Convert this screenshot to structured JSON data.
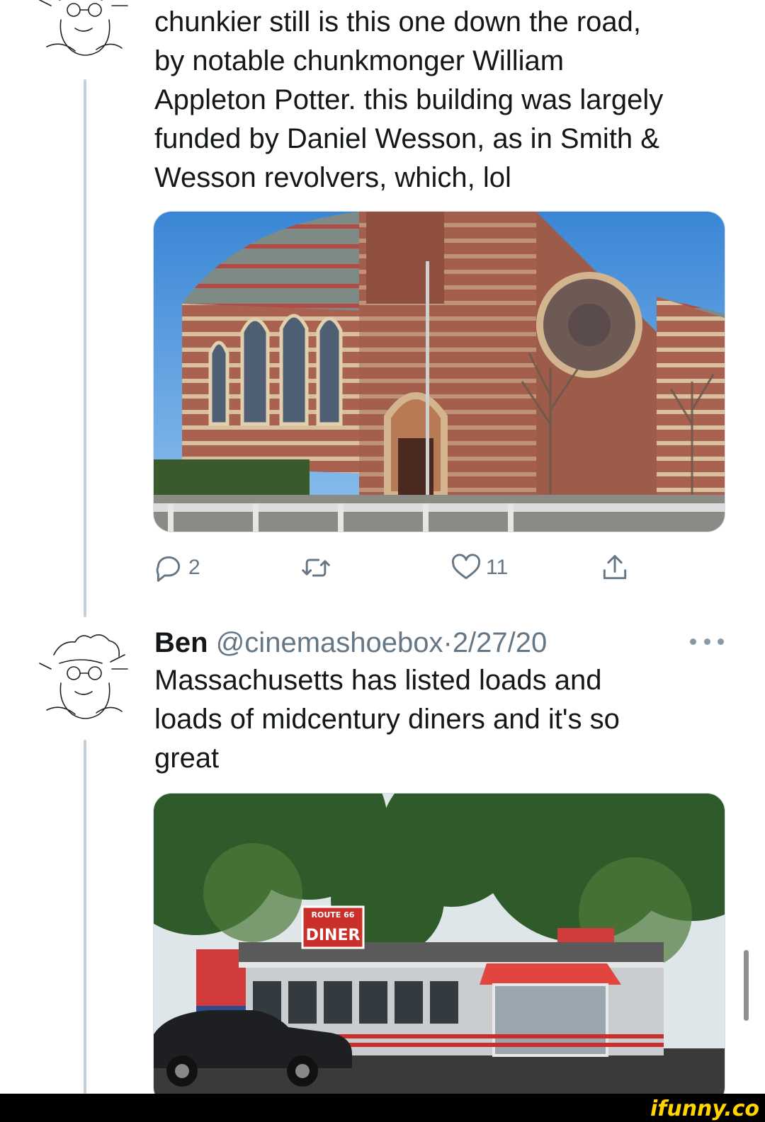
{
  "tweet1": {
    "text": "chunkier still is this one down the road,\nby notable chunkmonger William\nAppleton Potter. this building was largely\nfunded by Daniel Wesson, as in Smith &\nWesson revolvers, which, lol",
    "actions": {
      "reply_count": "2",
      "retweet_count": "",
      "like_count": "11"
    }
  },
  "tweet2": {
    "author_name": "Ben",
    "handle": "@cinemashoebox",
    "separator": "·",
    "date": "2/27/20",
    "text": "Massachusetts has listed loads and\nloads of midcentury diners and it's so\ngreat",
    "image_sign": {
      "small": "ROUTE 66",
      "big": "DINER"
    }
  },
  "watermark": "ifunny.co",
  "colors": {
    "text": "#14171a",
    "secondary": "#657786",
    "thread_line": "#c4cfd6",
    "watermark": "#ffd400"
  },
  "icons": [
    "avatar-sketch",
    "reply-icon",
    "retweet-icon",
    "like-icon",
    "share-icon",
    "more-icon"
  ]
}
